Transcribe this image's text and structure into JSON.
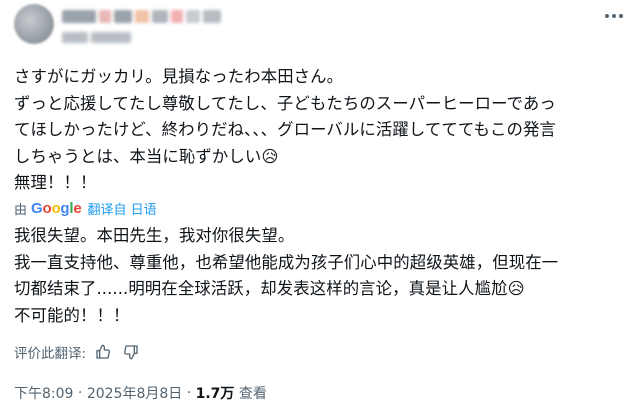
{
  "post": {
    "original_text": "さすがにガッカリ。見損なったわ本田さん。\nずっと応援してたし尊敬してたし、子どもたちのスーパーヒーローであっ\nてほしかったけど、終わりだね、、、グローバルに活躍してててもこの発言\nしちゃうとは、本当に恥ずかしい😥\n無理！！！"
  },
  "translation": {
    "by_label": "由",
    "google_label": "Google",
    "source_label": "翻译自 日语",
    "text": "我很失望。本田先生，我对你很失望。\n我一直支持他、尊重他，也希望他能成为孩子们心中的超级英雄，但现在一\n切都结束了......明明在全球活跃，却发表这样的言论，真是让人尴尬😥\n不可能的！！！"
  },
  "rating": {
    "label": "评价此翻译:"
  },
  "meta": {
    "time": "下午8:09",
    "separator": " · ",
    "date": "2025年8月8日",
    "views_count": "1.7万",
    "views_label": "查看"
  },
  "icons": {
    "more": "more-horizontal-icon",
    "thumb_up": "thumbs-up-icon",
    "thumb_down": "thumbs-down-icon"
  },
  "colors": {
    "text": "#0f1419",
    "secondary": "#536471",
    "link": "#1d9bf0"
  }
}
